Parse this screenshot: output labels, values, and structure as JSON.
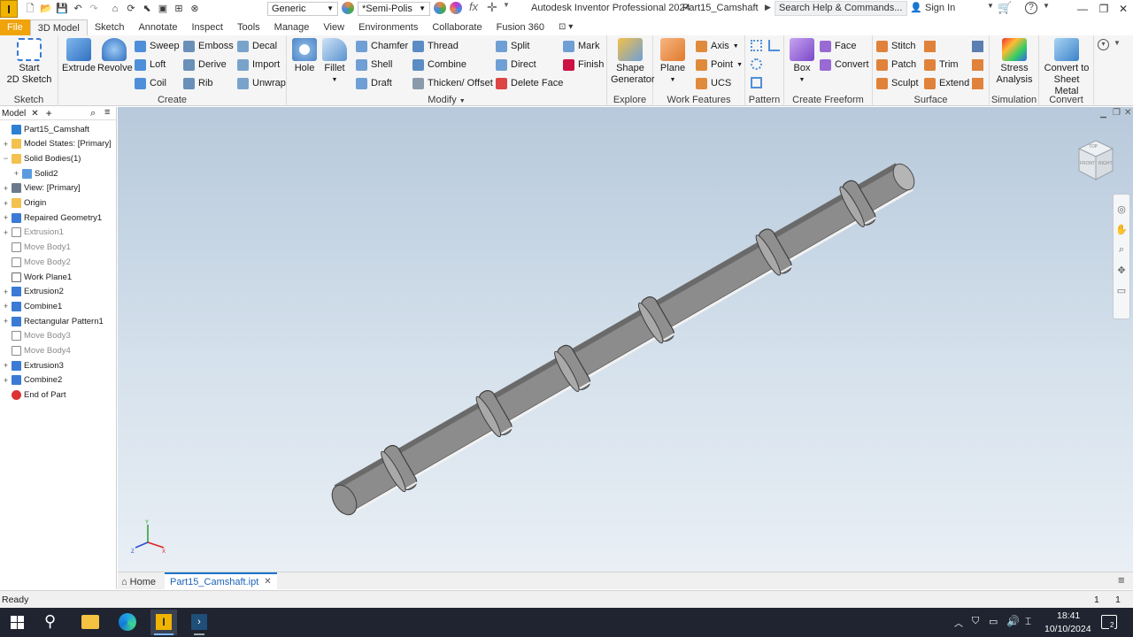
{
  "titlebar": {
    "app_logo": "I",
    "material": "Generic",
    "appearance": "*Semi-Polis",
    "app_title": "Autodesk Inventor Professional 2024",
    "doc_title": "Part15_Camshaft",
    "search_placeholder": "Search Help & Commands...",
    "sign_in": "Sign In"
  },
  "tabs": [
    "File",
    "3D Model",
    "Sketch",
    "Annotate",
    "Inspect",
    "Tools",
    "Manage",
    "View",
    "Environments",
    "Collaborate",
    "Fusion 360"
  ],
  "ribbon": {
    "sketch": {
      "title": "Sketch",
      "start": "Start",
      "start2": "2D Sketch"
    },
    "create": {
      "title": "Create",
      "extrude": "Extrude",
      "revolve": "Revolve",
      "sweep": "Sweep",
      "loft": "Loft",
      "coil": "Coil",
      "emboss": "Emboss",
      "derive": "Derive",
      "rib": "Rib",
      "decal": "Decal",
      "import": "Import",
      "unwrap": "Unwrap"
    },
    "modify": {
      "title": "Modify",
      "hole": "Hole",
      "fillet": "Fillet",
      "chamfer": "Chamfer",
      "shell": "Shell",
      "draft": "Draft",
      "thread": "Thread",
      "combine": "Combine",
      "thicken": "Thicken/ Offset",
      "split": "Split",
      "direct": "Direct",
      "delete_face": "Delete Face",
      "mark": "Mark",
      "finish": "Finish"
    },
    "explore": {
      "title": "Explore",
      "shape_gen": "Shape",
      "shape_gen2": "Generator"
    },
    "work_features": {
      "title": "Work Features",
      "plane": "Plane",
      "axis": "Axis",
      "point": "Point",
      "ucs": "UCS"
    },
    "pattern": {
      "title": "Pattern"
    },
    "freeform": {
      "title": "Create Freeform",
      "box": "Box",
      "face": "Face",
      "convert": "Convert"
    },
    "surface": {
      "title": "Surface",
      "stitch": "Stitch",
      "patch": "Patch",
      "sculpt": "Sculpt",
      "trim": "Trim",
      "extend": "Extend"
    },
    "simulation": {
      "title": "Simulation",
      "stress": "Stress",
      "stress2": "Analysis"
    },
    "convert": {
      "title": "Convert",
      "sheet": "Convert to",
      "sheet2": "Sheet Metal"
    }
  },
  "browser": {
    "tab": "Model",
    "items": [
      {
        "label": "Part15_Camshaft",
        "level": 0,
        "exp": "",
        "dim": false
      },
      {
        "label": "Model States: [Primary]",
        "level": 0,
        "exp": "+",
        "dim": false
      },
      {
        "label": "Solid Bodies(1)",
        "level": 0,
        "exp": "−",
        "dim": false
      },
      {
        "label": "Solid2",
        "level": 1,
        "exp": "+",
        "dim": false
      },
      {
        "label": "View: [Primary]",
        "level": 0,
        "exp": "+",
        "dim": false
      },
      {
        "label": "Origin",
        "level": 0,
        "exp": "+",
        "dim": false
      },
      {
        "label": "Repaired Geometry1",
        "level": 0,
        "exp": "+",
        "dim": false
      },
      {
        "label": "Extrusion1",
        "level": 0,
        "exp": "+",
        "dim": true
      },
      {
        "label": "Move Body1",
        "level": 0,
        "exp": "",
        "dim": true
      },
      {
        "label": "Move Body2",
        "level": 0,
        "exp": "",
        "dim": true
      },
      {
        "label": "Work Plane1",
        "level": 0,
        "exp": "",
        "dim": false
      },
      {
        "label": "Extrusion2",
        "level": 0,
        "exp": "+",
        "dim": false
      },
      {
        "label": "Combine1",
        "level": 0,
        "exp": "+",
        "dim": false
      },
      {
        "label": "Rectangular Pattern1",
        "level": 0,
        "exp": "+",
        "dim": false
      },
      {
        "label": "Move Body3",
        "level": 0,
        "exp": "",
        "dim": true
      },
      {
        "label": "Move Body4",
        "level": 0,
        "exp": "",
        "dim": true
      },
      {
        "label": "Extrusion3",
        "level": 0,
        "exp": "+",
        "dim": false
      },
      {
        "label": "Combine2",
        "level": 0,
        "exp": "+",
        "dim": false
      },
      {
        "label": "End of Part",
        "level": 0,
        "exp": "",
        "dim": false
      }
    ]
  },
  "viewcube": {
    "top": "TOP",
    "front": "FRONT",
    "right": "RIGHT"
  },
  "doctabs": {
    "home": "Home",
    "active": "Part15_Camshaft.ipt"
  },
  "status": {
    "text": "Ready",
    "count1": "1",
    "count2": "1"
  },
  "taskbar": {
    "time": "18:41",
    "date": "10/10/2024",
    "notif": "2"
  }
}
